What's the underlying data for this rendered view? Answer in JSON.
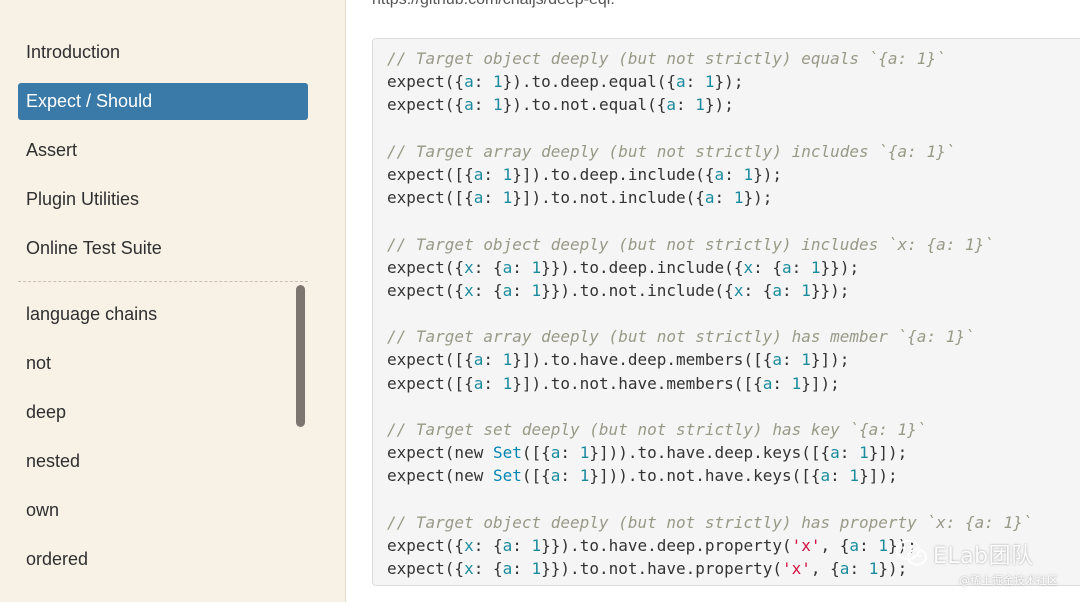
{
  "sidebar": {
    "top_items": [
      {
        "label": "Introduction",
        "active": false
      },
      {
        "label": "Expect / Should",
        "active": true
      },
      {
        "label": "Assert",
        "active": false
      },
      {
        "label": "Plugin Utilities",
        "active": false
      },
      {
        "label": "Online Test Suite",
        "active": false
      }
    ],
    "sub_items": [
      {
        "label": "language chains"
      },
      {
        "label": "not"
      },
      {
        "label": "deep"
      },
      {
        "label": "nested"
      },
      {
        "label": "own"
      },
      {
        "label": "ordered"
      }
    ],
    "active_color": "#3a7aa8",
    "background_color": "#f8f1e6"
  },
  "main": {
    "top_link": "https://github.com/chaijs/deep-eql.",
    "code_lines": [
      [
        [
          "comment",
          "// Target object deeply (but not strictly) equals `{a: 1}`"
        ]
      ],
      [
        [
          "plain",
          "expect({"
        ],
        [
          "prop",
          "a"
        ],
        [
          "plain",
          ": "
        ],
        [
          "num",
          "1"
        ],
        [
          "plain",
          "}).to.deep.equal({"
        ],
        [
          "prop",
          "a"
        ],
        [
          "plain",
          ": "
        ],
        [
          "num",
          "1"
        ],
        [
          "plain",
          "});"
        ]
      ],
      [
        [
          "plain",
          "expect({"
        ],
        [
          "prop",
          "a"
        ],
        [
          "plain",
          ": "
        ],
        [
          "num",
          "1"
        ],
        [
          "plain",
          "}).to.not.equal({"
        ],
        [
          "prop",
          "a"
        ],
        [
          "plain",
          ": "
        ],
        [
          "num",
          "1"
        ],
        [
          "plain",
          "});"
        ]
      ],
      [],
      [
        [
          "comment",
          "// Target array deeply (but not strictly) includes `{a: 1}`"
        ]
      ],
      [
        [
          "plain",
          "expect([{"
        ],
        [
          "prop",
          "a"
        ],
        [
          "plain",
          ": "
        ],
        [
          "num",
          "1"
        ],
        [
          "plain",
          "}]).to.deep.include({"
        ],
        [
          "prop",
          "a"
        ],
        [
          "plain",
          ": "
        ],
        [
          "num",
          "1"
        ],
        [
          "plain",
          "});"
        ]
      ],
      [
        [
          "plain",
          "expect([{"
        ],
        [
          "prop",
          "a"
        ],
        [
          "plain",
          ": "
        ],
        [
          "num",
          "1"
        ],
        [
          "plain",
          "}]).to.not.include({"
        ],
        [
          "prop",
          "a"
        ],
        [
          "plain",
          ": "
        ],
        [
          "num",
          "1"
        ],
        [
          "plain",
          "});"
        ]
      ],
      [],
      [
        [
          "comment",
          "// Target object deeply (but not strictly) includes `x: {a: 1}`"
        ]
      ],
      [
        [
          "plain",
          "expect({"
        ],
        [
          "prop",
          "x"
        ],
        [
          "plain",
          ": {"
        ],
        [
          "prop",
          "a"
        ],
        [
          "plain",
          ": "
        ],
        [
          "num",
          "1"
        ],
        [
          "plain",
          "}}).to.deep.include({"
        ],
        [
          "prop",
          "x"
        ],
        [
          "plain",
          ": {"
        ],
        [
          "prop",
          "a"
        ],
        [
          "plain",
          ": "
        ],
        [
          "num",
          "1"
        ],
        [
          "plain",
          "}});"
        ]
      ],
      [
        [
          "plain",
          "expect({"
        ],
        [
          "prop",
          "x"
        ],
        [
          "plain",
          ": {"
        ],
        [
          "prop",
          "a"
        ],
        [
          "plain",
          ": "
        ],
        [
          "num",
          "1"
        ],
        [
          "plain",
          "}}).to.not.include({"
        ],
        [
          "prop",
          "x"
        ],
        [
          "plain",
          ": {"
        ],
        [
          "prop",
          "a"
        ],
        [
          "plain",
          ": "
        ],
        [
          "num",
          "1"
        ],
        [
          "plain",
          "}});"
        ]
      ],
      [],
      [
        [
          "comment",
          "// Target array deeply (but not strictly) has member `{a: 1}`"
        ]
      ],
      [
        [
          "plain",
          "expect([{"
        ],
        [
          "prop",
          "a"
        ],
        [
          "plain",
          ": "
        ],
        [
          "num",
          "1"
        ],
        [
          "plain",
          "}]).to.have.deep.members([{"
        ],
        [
          "prop",
          "a"
        ],
        [
          "plain",
          ": "
        ],
        [
          "num",
          "1"
        ],
        [
          "plain",
          "}]);"
        ]
      ],
      [
        [
          "plain",
          "expect([{"
        ],
        [
          "prop",
          "a"
        ],
        [
          "plain",
          ": "
        ],
        [
          "num",
          "1"
        ],
        [
          "plain",
          "}]).to.not.have.members([{"
        ],
        [
          "prop",
          "a"
        ],
        [
          "plain",
          ": "
        ],
        [
          "num",
          "1"
        ],
        [
          "plain",
          "}]);"
        ]
      ],
      [],
      [
        [
          "comment",
          "// Target set deeply (but not strictly) has key `{a: 1}`"
        ]
      ],
      [
        [
          "plain",
          "expect(new "
        ],
        [
          "builtin",
          "Set"
        ],
        [
          "plain",
          "([{"
        ],
        [
          "prop",
          "a"
        ],
        [
          "plain",
          ": "
        ],
        [
          "num",
          "1"
        ],
        [
          "plain",
          "}])).to.have.deep.keys([{"
        ],
        [
          "prop",
          "a"
        ],
        [
          "plain",
          ": "
        ],
        [
          "num",
          "1"
        ],
        [
          "plain",
          "}]);"
        ]
      ],
      [
        [
          "plain",
          "expect(new "
        ],
        [
          "builtin",
          "Set"
        ],
        [
          "plain",
          "([{"
        ],
        [
          "prop",
          "a"
        ],
        [
          "plain",
          ": "
        ],
        [
          "num",
          "1"
        ],
        [
          "plain",
          "}])).to.not.have.keys([{"
        ],
        [
          "prop",
          "a"
        ],
        [
          "plain",
          ": "
        ],
        [
          "num",
          "1"
        ],
        [
          "plain",
          "}]);"
        ]
      ],
      [],
      [
        [
          "comment",
          "// Target object deeply (but not strictly) has property `x: {a: 1}`"
        ]
      ],
      [
        [
          "plain",
          "expect({"
        ],
        [
          "prop",
          "x"
        ],
        [
          "plain",
          ": {"
        ],
        [
          "prop",
          "a"
        ],
        [
          "plain",
          ": "
        ],
        [
          "num",
          "1"
        ],
        [
          "plain",
          "}}).to.have.deep.property("
        ],
        [
          "str",
          "'x'"
        ],
        [
          "plain",
          ", {"
        ],
        [
          "prop",
          "a"
        ],
        [
          "plain",
          ": "
        ],
        [
          "num",
          "1"
        ],
        [
          "plain",
          "});"
        ]
      ],
      [
        [
          "plain",
          "expect({"
        ],
        [
          "prop",
          "x"
        ],
        [
          "plain",
          ": {"
        ],
        [
          "prop",
          "a"
        ],
        [
          "plain",
          ": "
        ],
        [
          "num",
          "1"
        ],
        [
          "plain",
          "}}).to.not.have.property("
        ],
        [
          "str",
          "'x'"
        ],
        [
          "plain",
          ", {"
        ],
        [
          "prop",
          "a"
        ],
        [
          "plain",
          ": "
        ],
        [
          "num",
          "1"
        ],
        [
          "plain",
          "});"
        ]
      ]
    ]
  },
  "watermark": {
    "title": "ELab团队",
    "subtitle": "@稀土掘金技术社区",
    "icon": "wechat-icon"
  }
}
